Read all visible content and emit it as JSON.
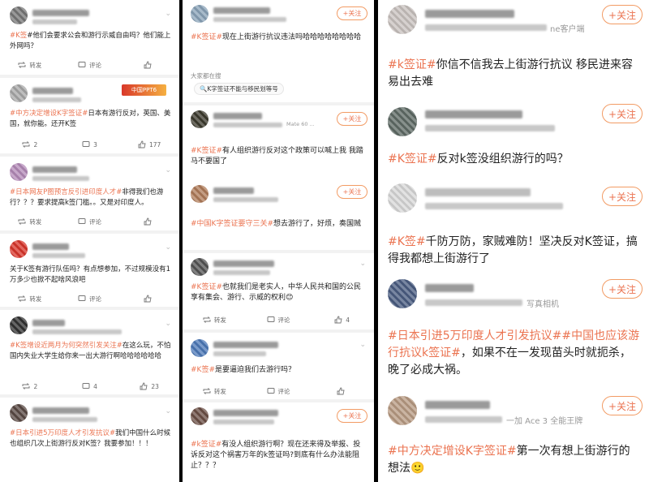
{
  "left": {
    "posts": [
      {
        "tag": "#K签",
        "text": "#他们会要求公会和游行示威自由吗？他们能上外网吗？",
        "repost": "转发",
        "comment": "评论",
        "like": ""
      },
      {
        "tag": "#中方决定增设K字签证#",
        "text": "日本有游行反对，英国、美国，就你能。还开K签",
        "repost": "2",
        "comment": "3",
        "like": "177"
      },
      {
        "tag": "#日本网友P图预言反引进印度人才#",
        "text": "非得我们也游行？？？要求提高k签门槛。。又是对印度人。",
        "repost": "转发",
        "comment": "评论",
        "like": ""
      },
      {
        "tag": "",
        "text": "关于K签有游行队伍吗？有点想参加，不过规模没有1万多少也掀不起啥风浪吧",
        "repost": "转发",
        "comment": "评论",
        "like": ""
      },
      {
        "tag": "#K签增设近两月为何突然引发关注#",
        "text": "在这么玩，不怕国内失业大学生给你来一出大游行啊哈哈哈哈哈哈",
        "repost": "2",
        "comment": "4",
        "like": "23"
      },
      {
        "tag": "#日本引进5万印度人才引发抗议#",
        "text": "我们中国什么时候也组织几次上街游行反对K签？我要参加！！！",
        "repost": "转发",
        "comment": "评论",
        "like": ""
      }
    ],
    "meta_2": "",
    "banner": "中国PPT6"
  },
  "mid": {
    "posts": [
      {
        "tag": "#K签证#",
        "text": "现在上街游行抗议违法吗哈哈哈哈哈哈哈哈",
        "follow": "+关注"
      },
      {
        "tag": "#K签证#",
        "text": "有人组织游行反对这个政策可以喊上我 我踏马不要国了",
        "follow": "+关注"
      },
      {
        "tag": "#中国K字签证要守三关#",
        "text": "想去游行了，好烦，奏国贼",
        "follow": "+关注"
      },
      {
        "tag": "#K签证#",
        "text": "也就我们是老实人，中华人民共和国的公民享有集会、游行、示威的权利😊",
        "repost": "转发",
        "comment": "评论",
        "like": "4"
      },
      {
        "tag": "#K签#",
        "text": "是要逼迫我们去游行吗？",
        "repost": "转发",
        "comment": "评论",
        "like": ""
      },
      {
        "tag": "#k签证#",
        "text": "有没人组织游行啊？现在还来得及举报、投诉反对这个祸害万年的k签证吗?到底有什么办法能阻止？？？",
        "follow": "+关注"
      }
    ],
    "section_label": "大家都在搜",
    "search_chip": "K字签证不能与移民划等号",
    "meta_2": "Mate 60 ..."
  },
  "right": {
    "posts": [
      {
        "tag": "#k签证#",
        "text": "你信不信我去上街游行抗议 移民进来容易出去难",
        "meta": "ne客户端",
        "follow": "+关注"
      },
      {
        "tag": "#K签证#",
        "text": "反对k签没组织游行的吗？",
        "meta": "",
        "follow": "+关注"
      },
      {
        "tag": "#K签#",
        "text": "千防万防，家贼难防！坚决反对K签证，搞得我都想上街游行了",
        "meta": "",
        "follow": "+关注"
      },
      {
        "tag": "#日本引进5万印度人才引发抗议##中国也应该游行抗议k签证#",
        "text": "，如果不在一发现苗头时就扼杀，晚了必成大祸。",
        "meta": "写真相机",
        "follow": "+关注"
      },
      {
        "tag": "#中方决定增设K字签证#",
        "text": "第一次有想上街游行的想法🙂",
        "meta": "一加 Ace 3 全能王牌",
        "follow": "+关注"
      }
    ]
  },
  "icons": {
    "repost": "repost-icon",
    "comment": "comment-icon",
    "like": "like-icon",
    "chevron": "chevron-down-icon"
  },
  "colors": {
    "tag": "#eb7350",
    "follow_border": "#f29b64",
    "separator": "#f2f2f2",
    "divider": "#000000"
  }
}
